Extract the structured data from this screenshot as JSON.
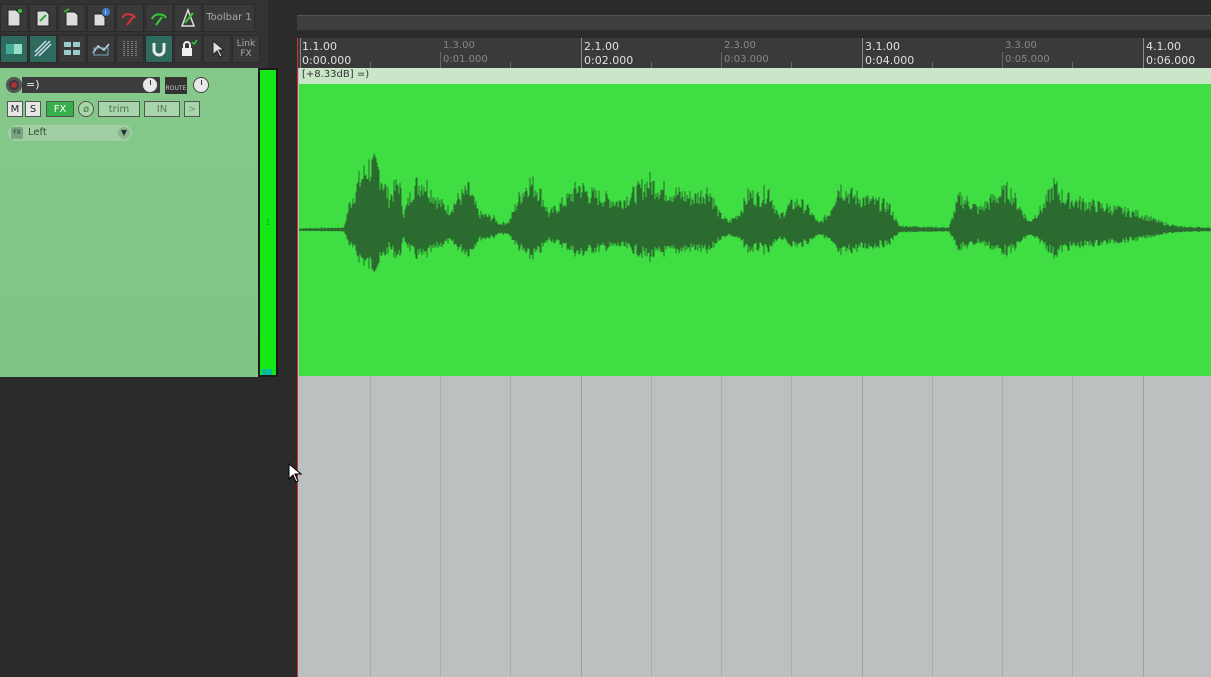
{
  "toolbar": {
    "name": "Toolbar 1",
    "link_fx_line1": "Link",
    "link_fx_line2": "FX"
  },
  "ruler": {
    "major": [
      {
        "bar": "1.1.00",
        "time": "0:00.000"
      },
      {
        "bar": "2.1.00",
        "time": "0:02.000"
      },
      {
        "bar": "3.1.00",
        "time": "0:04.000"
      },
      {
        "bar": "4.1.00",
        "time": "0:06.000"
      }
    ],
    "minor": [
      {
        "bar": "1.3.00",
        "time": "0:01.000"
      },
      {
        "bar": "2.3.00",
        "time": "0:03.000"
      },
      {
        "bar": "3.3.00",
        "time": "0:05.000"
      }
    ]
  },
  "track": {
    "name": "=)",
    "route_label": "ROUTE",
    "mute": "M",
    "solo": "S",
    "fx": "FX",
    "trim": "trim",
    "input": "IN",
    "pan_mode": "Left",
    "number": "1",
    "color": "#3fdf44"
  },
  "item": {
    "label": "[+8.33dB] =)"
  }
}
